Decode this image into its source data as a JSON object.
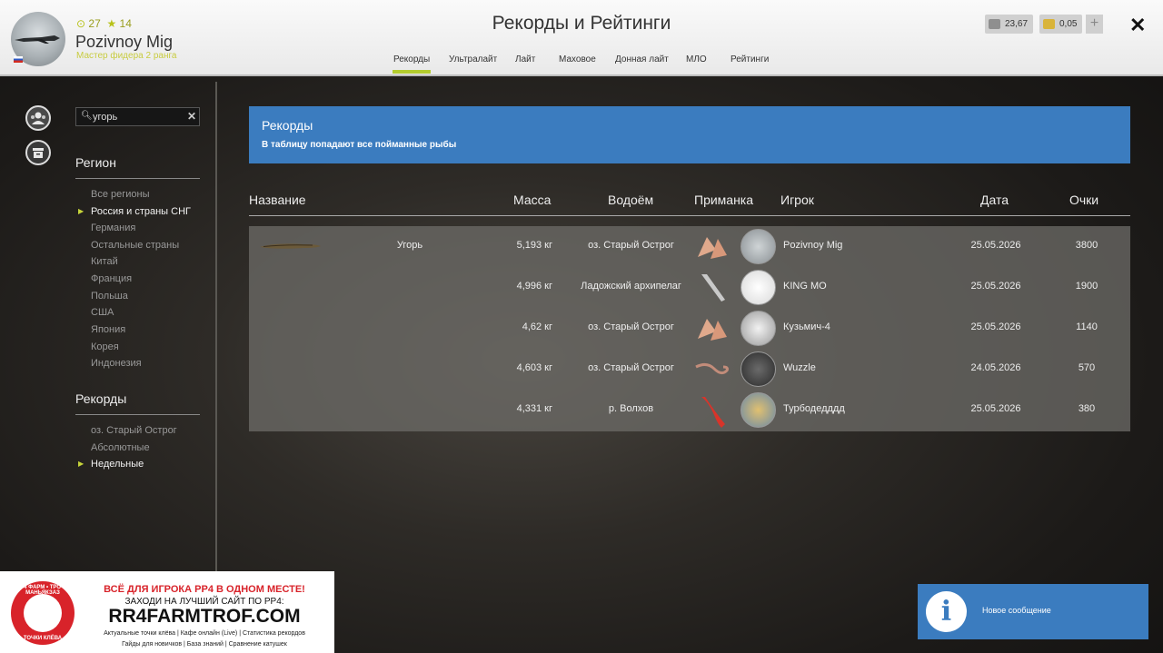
{
  "header": {
    "title": "Рекорды и Рейтинги",
    "user": {
      "name": "Pozivnoy Mig",
      "rank": "Мастер фидера 2 ранга",
      "level_a": "27",
      "level_b": "14"
    },
    "tabs": [
      "Рекорды",
      "Ультралайт",
      "Лайт",
      "Маховое",
      "Донная лайт",
      "МЛО",
      "Рейтинги"
    ],
    "active_tab": "Рекорды",
    "silver": "23,67",
    "gold": "0,05",
    "plus_label": "+",
    "close_label": "✕"
  },
  "sidebar": {
    "search_value": "угорь",
    "region_title": "Регион",
    "regions": [
      "Все регионы",
      "Россия и страны СНГ",
      "Германия",
      "Остальные страны",
      "Китай",
      "Франция",
      "Польша",
      "США",
      "Япония",
      "Корея",
      "Индонезия"
    ],
    "selected_region": "Россия и страны СНГ",
    "records_title": "Рекорды",
    "records": [
      "оз. Старый Острог",
      "Абсолютные",
      "Недельные"
    ],
    "selected_record": "Недельные"
  },
  "banner": {
    "title": "Рекорды",
    "subtitle": "В таблицу попадают все пойманные рыбы"
  },
  "table": {
    "headers": {
      "name": "Название",
      "mass": "Масса",
      "water": "Водоём",
      "bait": "Приманка",
      "player": "Игрок",
      "date": "Дата",
      "score": "Очки"
    },
    "fish": "Угорь",
    "rows": [
      {
        "mass": "5,193 кг",
        "water": "оз. Старый Острог",
        "player": "Pozivnoy Mig",
        "date": "25.05.2026",
        "score": "3800"
      },
      {
        "mass": "4,996 кг",
        "water": "Ладожский архипелаг",
        "player": "KING MO",
        "date": "25.05.2026",
        "score": "1900"
      },
      {
        "mass": "4,62 кг",
        "water": "оз. Старый Острог",
        "player": "Кузьмич-4",
        "date": "25.05.2026",
        "score": "1140"
      },
      {
        "mass": "4,603 кг",
        "water": "оз. Старый Острог",
        "player": "Wuzzle",
        "date": "24.05.2026",
        "score": "570"
      },
      {
        "mass": "4,331 кг",
        "water": "р. Волхов",
        "player": "Турбодедддд",
        "date": "25.05.2026",
        "score": "380"
      }
    ]
  },
  "ad": {
    "line1": "ВСЁ ДЛЯ ИГРОКА РР4 В ОДНОМ МЕСТЕ!",
    "line2": "ЗАХОДИ НА ЛУЧШИЙ САЙТ ПО РР4:",
    "site": "RR4FARMTROF.COM",
    "line4": "Актуальные точки клёва  |  Кафе онлайн (Live)  |  Статистика рекордов",
    "line5": "Гайды для новичков  |  База знаний  |  Сравнение катушек",
    "logo_top": "РР4 ФАРМ • ТРОФ • МАНЬЯКЗАЗ",
    "logo_bottom": "ТОЧКИ КЛЁВА"
  },
  "notification": {
    "text": "Новое сообщение"
  },
  "colors": {
    "accent": "#3b7cbf",
    "tab_underline": "#b3cc2e"
  }
}
